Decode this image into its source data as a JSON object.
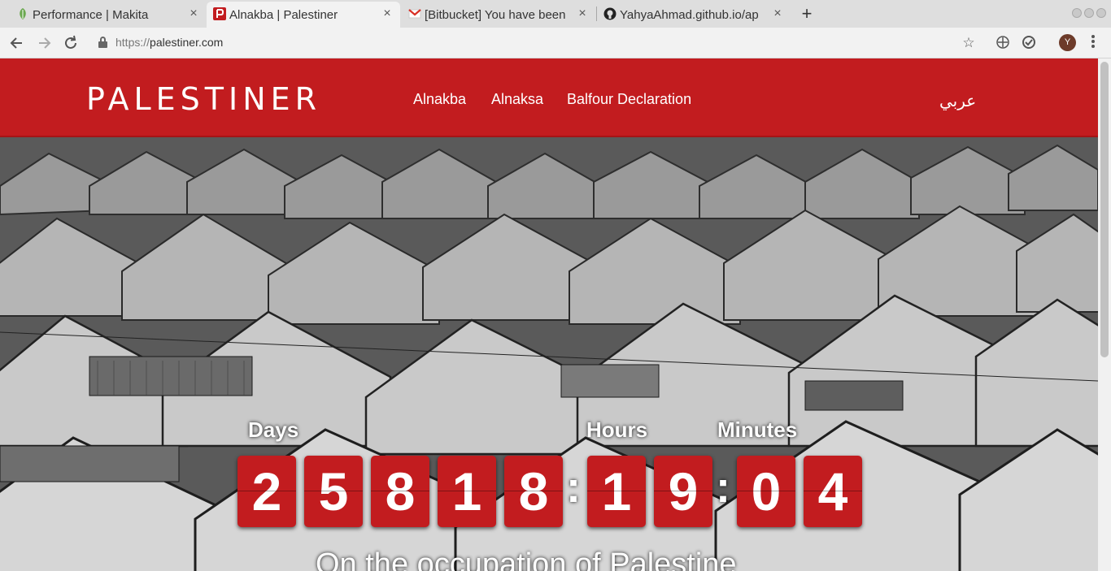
{
  "browser": {
    "tabs": [
      {
        "title": "Performance | Makita",
        "close": "×"
      },
      {
        "title": "Alnakba | Palestiner",
        "close": "×"
      },
      {
        "title": "[Bitbucket] You have been",
        "close": "×"
      },
      {
        "title": "YahyaAhmad.github.io/ap",
        "close": "×"
      }
    ],
    "new_tab": "+",
    "url_scheme": "https://",
    "url_host": "palestiner.com",
    "avatar_initial": "Y"
  },
  "site": {
    "logo": "PALESTINER",
    "nav": [
      "Alnakba",
      "Alnaksa",
      "Balfour Declaration"
    ],
    "lang": "عربي"
  },
  "countdown": {
    "labels": {
      "days": "Days",
      "hours": "Hours",
      "minutes": "Minutes"
    },
    "days_digits": [
      "2",
      "5",
      "8",
      "1",
      "8"
    ],
    "hours_digits": [
      "1",
      "9"
    ],
    "minutes_digits": [
      "0",
      "4"
    ],
    "separator": ":"
  },
  "hero": {
    "tagline": "On the occupation of Palestine"
  },
  "colors": {
    "brand_red": "#c21c1f"
  }
}
